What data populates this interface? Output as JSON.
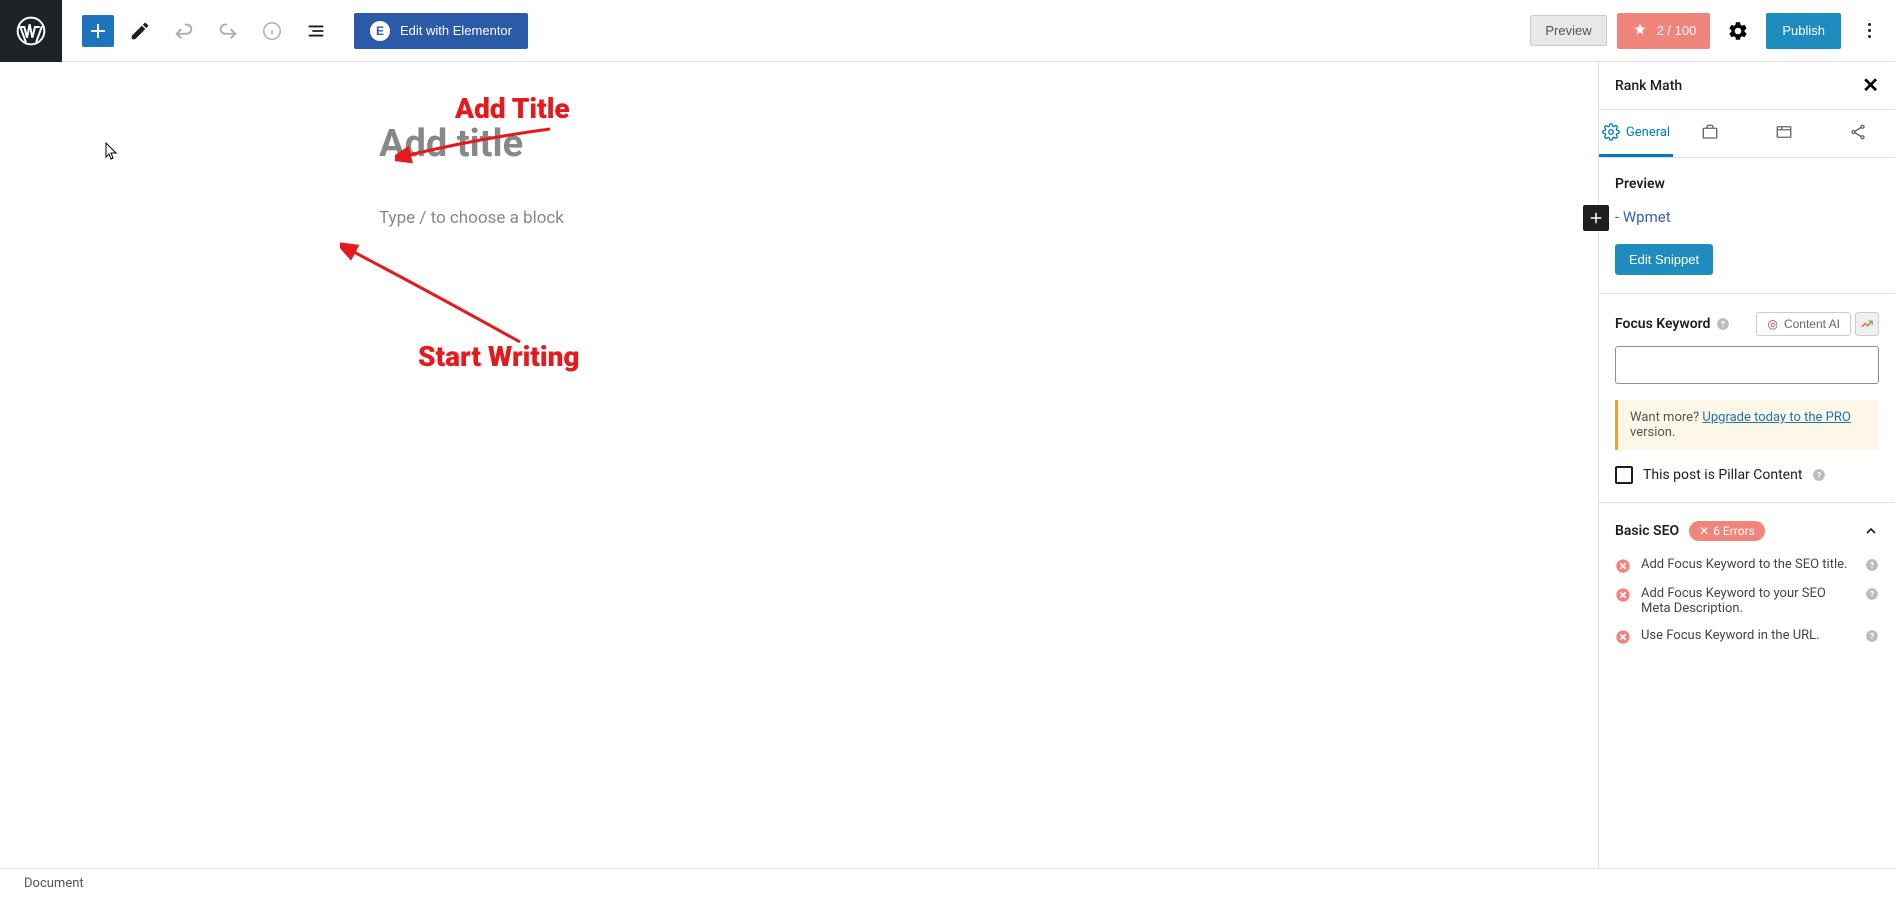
{
  "toolbar": {
    "elementor_label": "Edit with Elementor",
    "preview_label": "Preview",
    "score_label": "2 / 100",
    "publish_label": "Publish"
  },
  "editor": {
    "title_placeholder": "Add title",
    "block_placeholder": "Type / to choose a block"
  },
  "annotations": {
    "add_title": "Add Title",
    "start_writing": "Start Writing"
  },
  "sidebar": {
    "header_title": "Rank Math",
    "tabs": {
      "general": "General"
    },
    "preview": {
      "title": "Preview",
      "link": "- Wpmet",
      "edit_snippet": "Edit Snippet"
    },
    "focus": {
      "label": "Focus Keyword",
      "content_ai": "Content AI"
    },
    "upgrade": {
      "prefix": "Want more? ",
      "link": "Upgrade today to the PRO",
      "suffix": " version."
    },
    "pillar_label": "This post is Pillar Content",
    "basic_seo": {
      "title": "Basic SEO",
      "error_count": "6 Errors",
      "items": [
        "Add Focus Keyword to the SEO title.",
        "Add Focus Keyword to your SEO Meta Description.",
        "Use Focus Keyword in the URL."
      ]
    }
  },
  "bottom": {
    "document": "Document"
  }
}
